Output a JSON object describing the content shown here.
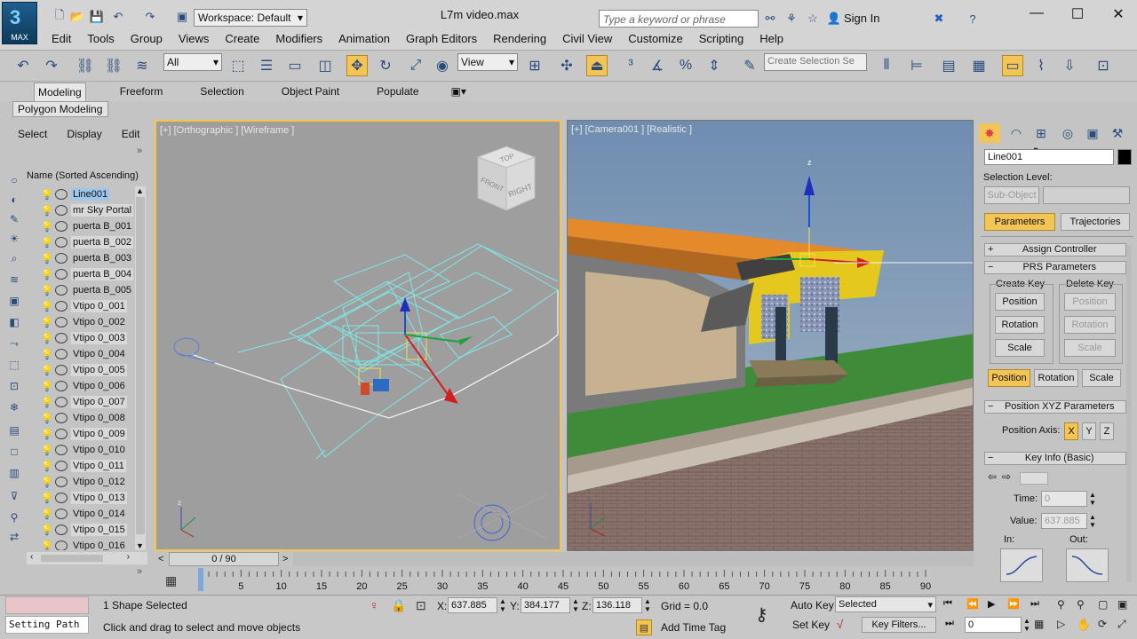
{
  "titlebar": {
    "app_badge": "MAX",
    "workspace": "Workspace: Default",
    "file_title": "L7m video.max",
    "search_placeholder": "Type a keyword or phrase",
    "sign_in": "Sign In"
  },
  "menu": [
    "Edit",
    "Tools",
    "Group",
    "Views",
    "Create",
    "Modifiers",
    "Animation",
    "Graph Editors",
    "Rendering",
    "Civil View",
    "Customize",
    "Scripting",
    "Help"
  ],
  "toolbar": {
    "filter": "All",
    "ref_coord": "View",
    "create_selection_placeholder": "Create Selection Se"
  },
  "ribbon": {
    "tabs": [
      "Modeling",
      "Freeform",
      "Selection",
      "Object Paint",
      "Populate"
    ],
    "sub": "Polygon Modeling"
  },
  "scene_explorer": {
    "tabs": [
      "Select",
      "Display",
      "Edit"
    ],
    "header": "Name (Sorted Ascending)",
    "items": [
      "Line001",
      "mr Sky Portal",
      "puerta B_001",
      "puerta B_002",
      "puerta B_003",
      "puerta B_004",
      "puerta B_005",
      "Vtipo 0_001",
      "Vtipo 0_002",
      "Vtipo 0_003",
      "Vtipo 0_004",
      "Vtipo 0_005",
      "Vtipo 0_006",
      "Vtipo 0_007",
      "Vtipo 0_008",
      "Vtipo 0_009",
      "Vtipo 0_010",
      "Vtipo 0_011",
      "Vtipo 0_012",
      "Vtipo 0_013",
      "Vtipo 0_014",
      "Vtipo 0_015",
      "Vtipo 0_016"
    ]
  },
  "viewports": {
    "left_label": "[+] [Orthographic ] [Wireframe ]",
    "right_label": "[+] [Camera001 ] [Realistic ]",
    "cube_top": "TOP",
    "cube_front": "FRONT",
    "cube_right": "RIGHT"
  },
  "command_panel": {
    "object_name": "Line001",
    "selection_level": "Selection Level:",
    "sub_object": "Sub-Object",
    "parameters": "Parameters",
    "trajectories": "Trajectories",
    "assign_controller": "Assign Controller",
    "prs_parameters": "PRS Parameters",
    "create_key": "Create Key",
    "delete_key": "Delete Key",
    "position": "Position",
    "rotation": "Rotation",
    "scale": "Scale",
    "pos_xyz": "Position XYZ Parameters",
    "position_axis": "Position Axis:",
    "axis_x": "X",
    "axis_y": "Y",
    "axis_z": "Z",
    "key_info": "Key Info (Basic)",
    "time_label": "Time:",
    "time_value": "0",
    "value_label": "Value:",
    "value_value": "637.885",
    "in_label": "In:",
    "out_label": "Out:"
  },
  "timeline": {
    "slider": "0 / 90",
    "ticks": [
      "0",
      "5",
      "10",
      "15",
      "20",
      "25",
      "30",
      "35",
      "40",
      "45",
      "50",
      "55",
      "60",
      "65",
      "70",
      "75",
      "80",
      "85",
      "90"
    ]
  },
  "status": {
    "setting_path": "Setting Path",
    "selected": "1 Shape Selected",
    "prompt": "Click and drag to select and move objects",
    "x_label": "X:",
    "x_value": "637.885",
    "y_label": "Y:",
    "y_value": "384.177",
    "z_label": "Z:",
    "z_value": "136.118",
    "grid": "Grid = 0.0",
    "add_time_tag": "Add Time Tag",
    "auto_key": "Auto Key",
    "set_key": "Set Key",
    "key_mode": "Selected",
    "key_filters": "Key Filters...",
    "frame": "0"
  }
}
